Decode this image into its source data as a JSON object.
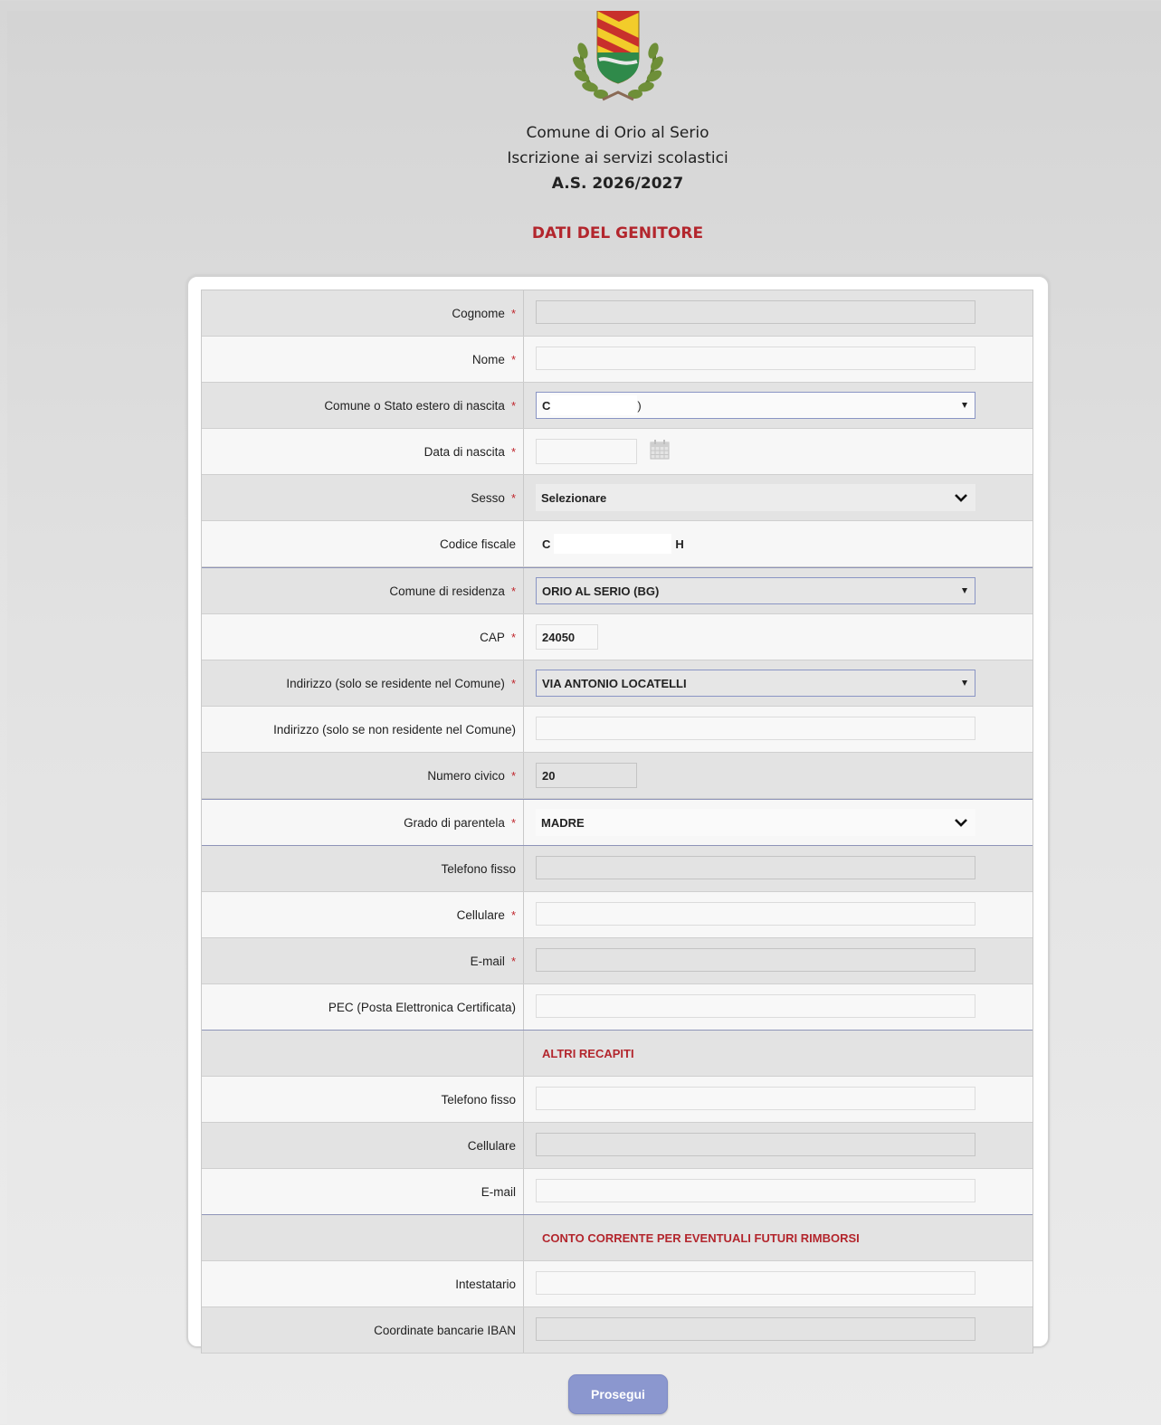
{
  "header": {
    "line1": "Comune di Orio al Serio",
    "line2": "Iscrizione ai servizi scolastici",
    "line3": "A.S. 2026/2027",
    "section_title": "DATI DEL GENITORE"
  },
  "form": {
    "cognome": {
      "label": "Cognome",
      "value": ""
    },
    "nome": {
      "label": "Nome",
      "value": ""
    },
    "comune_nascita": {
      "label": "Comune o Stato estero di nascita",
      "value_start": "C",
      "value_end": ")"
    },
    "data_nascita": {
      "label": "Data di nascita",
      "value": ""
    },
    "sesso": {
      "label": "Sesso",
      "value": "Selezionare"
    },
    "codice_fiscale": {
      "label": "Codice fiscale",
      "value_start": "C",
      "value_end": "H"
    },
    "comune_residenza": {
      "label": "Comune di residenza",
      "value": "ORIO AL SERIO (BG)"
    },
    "cap": {
      "label": "CAP",
      "value": "24050"
    },
    "indirizzo_residente": {
      "label": "Indirizzo (solo se residente nel Comune)",
      "value": "VIA ANTONIO LOCATELLI"
    },
    "indirizzo_non_residente": {
      "label": "Indirizzo (solo se non residente nel Comune)",
      "value": ""
    },
    "numero_civico": {
      "label": "Numero civico",
      "value": "20"
    },
    "grado_parentela": {
      "label": "Grado di parentela",
      "value": "MADRE"
    },
    "telefono_fisso": {
      "label": "Telefono fisso",
      "value": ""
    },
    "cellulare": {
      "label": "Cellulare",
      "value": ""
    },
    "email": {
      "label": "E-mail",
      "value": ""
    },
    "pec": {
      "label": "PEC (Posta Elettronica Certificata)",
      "value": ""
    },
    "altri_recapiti_title": "ALTRI RECAPITI",
    "altri_telefono_fisso": {
      "label": "Telefono fisso",
      "value": ""
    },
    "altri_cellulare": {
      "label": "Cellulare",
      "value": ""
    },
    "altri_email": {
      "label": "E-mail",
      "value": ""
    },
    "conto_title": "CONTO CORRENTE PER EVENTUALI FUTURI RIMBORSI",
    "intestatario": {
      "label": "Intestatario",
      "value": ""
    },
    "iban": {
      "label": "Coordinate bancarie IBAN",
      "value": ""
    }
  },
  "required_mark": "*",
  "buttons": {
    "prosegui": "Prosegui"
  },
  "colors": {
    "accent_red": "#b3262d",
    "button": "#8b97cf",
    "select_border": "#8a95c4"
  }
}
